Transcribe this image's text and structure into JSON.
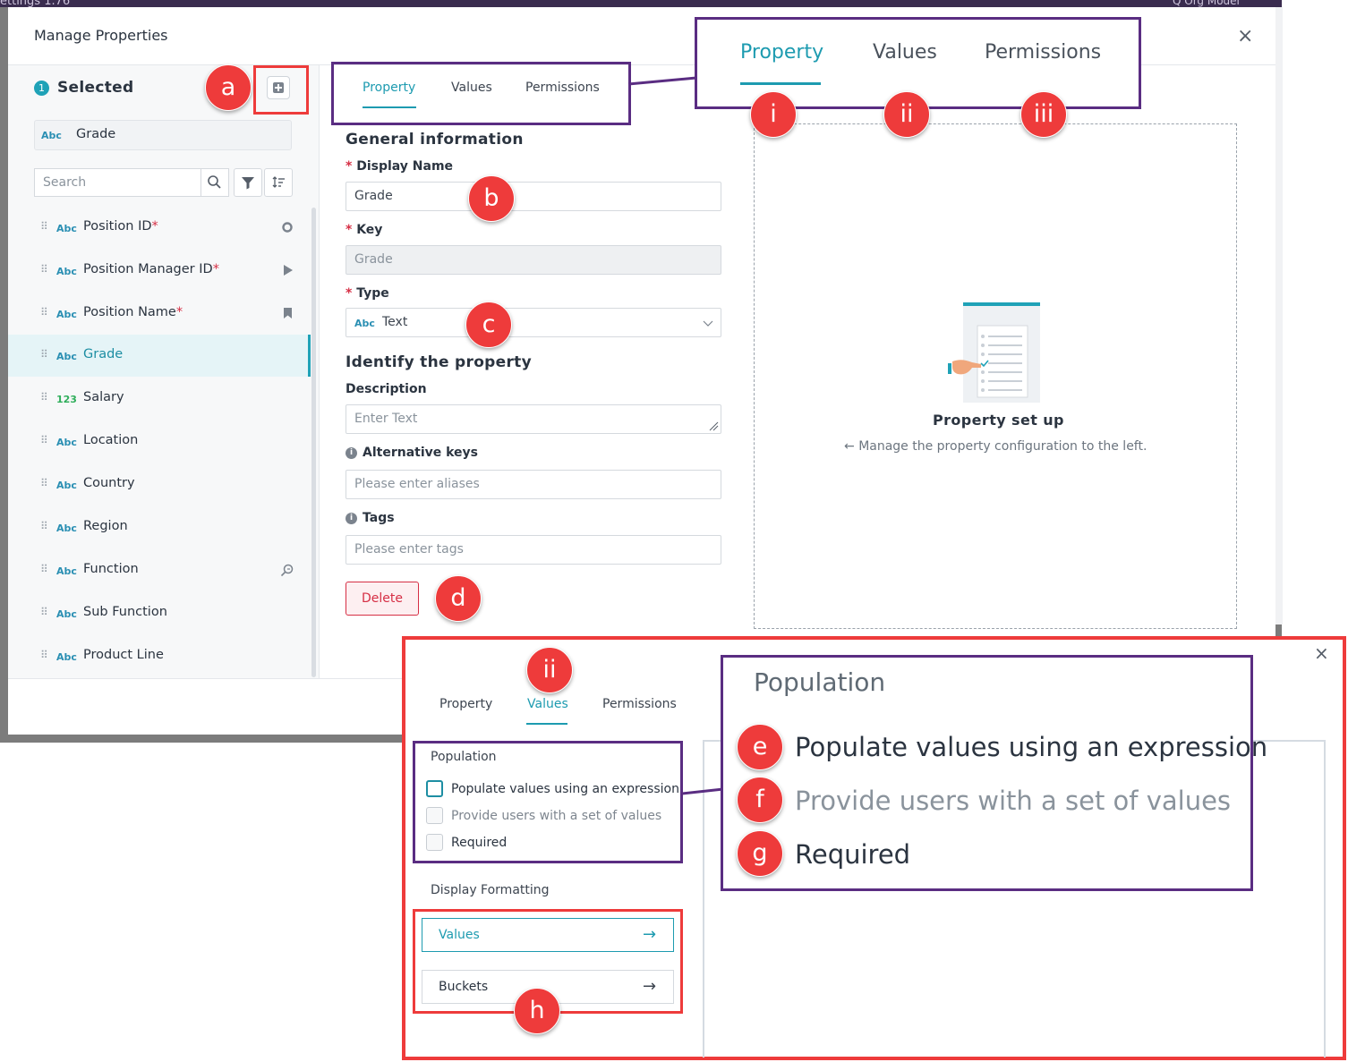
{
  "background": {
    "left_text": "ettings 1.76",
    "right_text": "Q  Org Model"
  },
  "modal": {
    "title": "Manage Properties",
    "close_glyph": "×"
  },
  "left": {
    "selected_count": "1",
    "selected_label": "Selected",
    "chip_type": "Abc",
    "chip_label": "Grade",
    "search_placeholder": "Search",
    "items": [
      {
        "type": "Abc",
        "label": "Position ID",
        "required": "*",
        "icon": "circle-icon"
      },
      {
        "type": "Abc",
        "label": "Position Manager ID",
        "required": "*",
        "icon": "play-icon"
      },
      {
        "type": "Abc",
        "label": "Position Name",
        "required": "*",
        "icon": "bookmark-icon"
      },
      {
        "type": "Abc",
        "label": "Grade",
        "required": "",
        "icon": ""
      },
      {
        "type": "123",
        "label": "Salary",
        "required": "",
        "icon": ""
      },
      {
        "type": "Abc",
        "label": "Location",
        "required": "",
        "icon": ""
      },
      {
        "type": "Abc",
        "label": "Country",
        "required": "",
        "icon": ""
      },
      {
        "type": "Abc",
        "label": "Region",
        "required": "",
        "icon": ""
      },
      {
        "type": "Abc",
        "label": "Function",
        "required": "",
        "icon": "key-search-icon"
      },
      {
        "type": "Abc",
        "label": "Sub Function",
        "required": "",
        "icon": ""
      },
      {
        "type": "Abc",
        "label": "Product Line",
        "required": "",
        "icon": ""
      }
    ]
  },
  "tabs": [
    "Property",
    "Values",
    "Permissions"
  ],
  "form": {
    "general_heading": "General information",
    "display_name_label": "Display Name",
    "display_name_value": "Grade",
    "key_label": "Key",
    "key_value": "Grade",
    "type_label": "Type",
    "type_badge": "Abc",
    "type_value": "Text",
    "identify_heading": "Identify the property",
    "description_label": "Description",
    "description_placeholder": "Enter Text",
    "alt_keys_label": "Alternative keys",
    "alt_keys_placeholder": "Please enter aliases",
    "tags_label": "Tags",
    "tags_placeholder": "Please enter tags",
    "delete_label": "Delete",
    "required_mark": "*",
    "info_glyph": "i"
  },
  "setup": {
    "title": "Property set up",
    "subtitle": "Manage the property configuration to the left."
  },
  "callouts": {
    "a": "a",
    "b": "b",
    "c": "c",
    "d": "d",
    "e": "e",
    "f": "f",
    "g": "g",
    "h": "h",
    "i": "i",
    "ii": "ii",
    "iii": "iii"
  },
  "popup": {
    "tabs": [
      "Property",
      "Values",
      "Permissions"
    ],
    "population_title": "Population",
    "options": [
      "Populate values using an expression",
      "Provide users with a set of values",
      "Required"
    ],
    "display_formatting_title": "Display Formatting",
    "formatting_buttons": [
      "Values",
      "Buckets"
    ]
  },
  "colors": {
    "accent": "#1d9bb0",
    "callout": "#ee3b3b",
    "highlight_box": "#5a2d82",
    "required": "#d62f45"
  }
}
